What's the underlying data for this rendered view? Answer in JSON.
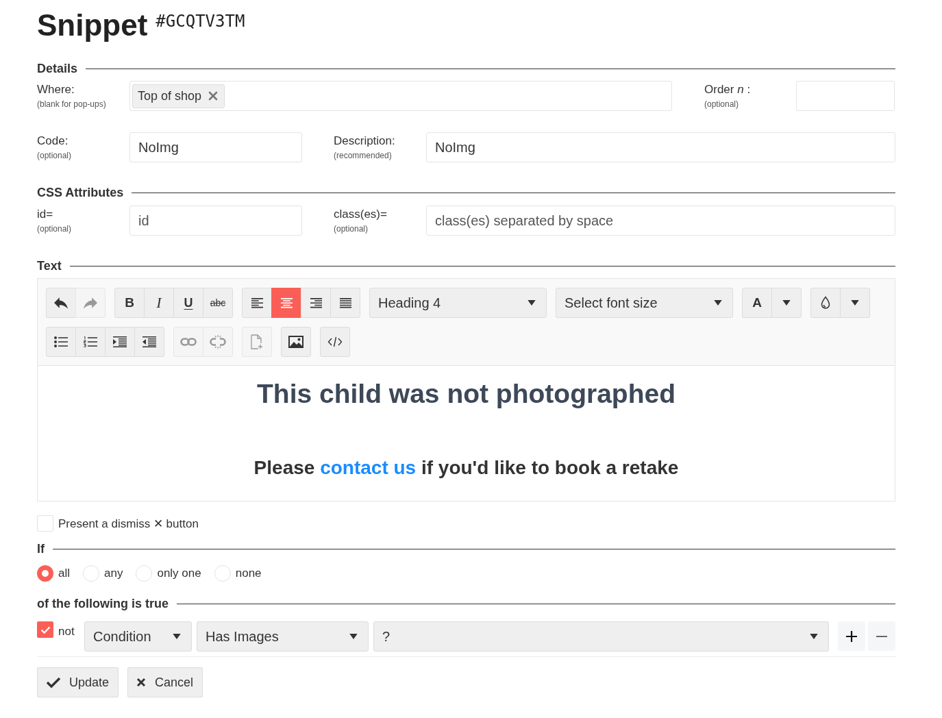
{
  "header": {
    "title": "Snippet",
    "code": "#GCQTV3TM"
  },
  "details": {
    "heading": "Details",
    "where": {
      "label": "Where:",
      "hint": "(blank for pop-ups)",
      "tags": [
        {
          "text": "Top of shop"
        }
      ]
    },
    "order": {
      "label": "Order *n* :",
      "hint": "(optional)"
    },
    "code": {
      "label": "Code:",
      "hint": "(optional)",
      "value": "NoImg"
    },
    "description": {
      "label": "Description:",
      "hint": "(recommended)",
      "value": "NoImg"
    }
  },
  "css_attributes": {
    "heading": "CSS Attributes",
    "id": {
      "label": "id=",
      "hint": "(optional)",
      "placeholder": "id"
    },
    "classes": {
      "label": "class(es)=",
      "hint": "(optional)",
      "placeholder": "class(es) separated by space"
    }
  },
  "text": {
    "heading": "Text",
    "toolbar_rows": [
      {
        "groups": [
          {
            "items": [
              {
                "kind": "undo",
                "disabled": false,
                "selected": false
              },
              {
                "kind": "redo",
                "disabled": true,
                "selected": false
              }
            ]
          },
          {
            "items": [
              {
                "kind": "bold",
                "label": "B",
                "disabled": false,
                "selected": false
              },
              {
                "kind": "italic",
                "label": "I",
                "disabled": false,
                "selected": false
              },
              {
                "kind": "underline",
                "label": "U",
                "disabled": false,
                "selected": false
              },
              {
                "kind": "strike",
                "label": "abc",
                "disabled": false,
                "selected": false
              }
            ]
          },
          {
            "items": [
              {
                "kind": "align-left",
                "disabled": false,
                "selected": false
              },
              {
                "kind": "align-center",
                "disabled": false,
                "selected": true
              },
              {
                "kind": "align-right",
                "disabled": false,
                "selected": false
              },
              {
                "kind": "align-justify",
                "disabled": false,
                "selected": false
              }
            ]
          },
          {
            "items": [
              {
                "kind": "select",
                "value": "Heading 4"
              }
            ]
          },
          {
            "items": [
              {
                "kind": "select",
                "placeholder": "Select font size"
              }
            ]
          },
          {
            "items": [
              {
                "kind": "font-color",
                "label": "A",
                "disabled": false,
                "selected": false
              },
              {
                "kind": "dropdown",
                "disabled": false,
                "selected": false
              }
            ]
          },
          {
            "items": [
              {
                "kind": "highlight",
                "disabled": false,
                "selected": false
              },
              {
                "kind": "dropdown",
                "disabled": false,
                "selected": false
              }
            ]
          }
        ]
      },
      {
        "groups": [
          {
            "items": [
              {
                "kind": "bullet-list",
                "disabled": false,
                "selected": false
              },
              {
                "kind": "number-list",
                "disabled": false,
                "selected": false
              },
              {
                "kind": "indent",
                "disabled": false,
                "selected": false
              },
              {
                "kind": "outdent",
                "disabled": false,
                "selected": false
              }
            ]
          },
          {
            "items": [
              {
                "kind": "link",
                "disabled": true,
                "selected": false
              },
              {
                "kind": "unlink",
                "disabled": true,
                "selected": false
              }
            ]
          },
          {
            "items": [
              {
                "kind": "template",
                "disabled": true,
                "selected": false
              }
            ]
          },
          {
            "items": [
              {
                "kind": "image",
                "disabled": false,
                "selected": false
              }
            ]
          },
          {
            "items": [
              {
                "kind": "code",
                "disabled": false,
                "selected": false
              }
            ]
          }
        ]
      }
    ],
    "content": {
      "heading": "This child was not photographed",
      "paragraph": {
        "before": "Please ",
        "link": "contact us",
        "after": " if you'd like to book a retake"
      }
    }
  },
  "dismiss": {
    "label": "Present a dismiss ✕ button",
    "checked": false
  },
  "if": {
    "heading": "If",
    "options": [
      {
        "label": "all",
        "selected": true
      },
      {
        "label": "any",
        "selected": false
      },
      {
        "label": "only one",
        "selected": false
      },
      {
        "label": "none",
        "selected": false
      }
    ]
  },
  "conditions": {
    "heading": "of the following is true",
    "rows": [
      {
        "negate": {
          "label": "not",
          "checked": true
        },
        "type": "Condition",
        "field": "Has Images",
        "value": "?"
      }
    ]
  },
  "actions": [
    {
      "kind": "update",
      "label": "Update"
    },
    {
      "kind": "cancel",
      "label": "Cancel"
    }
  ]
}
